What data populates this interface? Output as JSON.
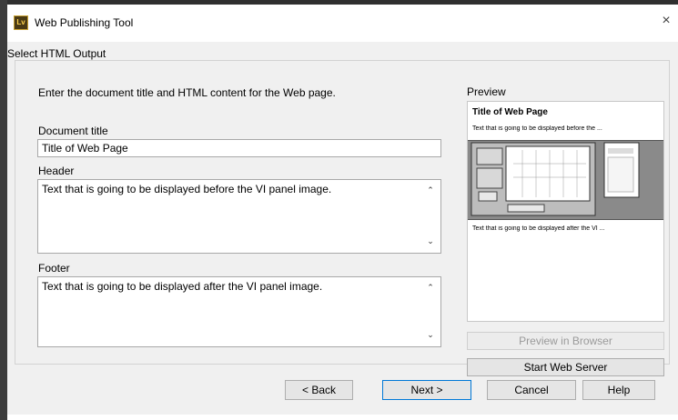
{
  "window": {
    "title": "Web Publishing Tool",
    "icon_text": "Lv",
    "close_glyph": "×"
  },
  "group": {
    "label": "Select HTML Output"
  },
  "instructions": "Enter the document title and HTML content for the Web page.",
  "document_title": {
    "label": "Document title",
    "value": "Title of Web Page"
  },
  "header": {
    "label": "Header",
    "value": "Text that is going to be displayed before the VI panel image."
  },
  "footer": {
    "label": "Footer",
    "value": "Text that is going to be displayed after the VI panel image."
  },
  "preview": {
    "label": "Preview",
    "title": "Title of Web Page",
    "before_text": "Text that is going to be displayed before the ...",
    "after_text": "Text that is going to be displayed after the VI ..."
  },
  "buttons": {
    "preview_in_browser": "Preview in Browser",
    "start_web_server": "Start Web Server",
    "back": "< Back",
    "next": "Next >",
    "cancel": "Cancel",
    "help": "Help"
  },
  "scroll_glyphs": {
    "up": "⌃",
    "down": "⌄"
  },
  "colors": {
    "accent": "#0078d7",
    "dialog_bg": "#f0f0f0"
  }
}
